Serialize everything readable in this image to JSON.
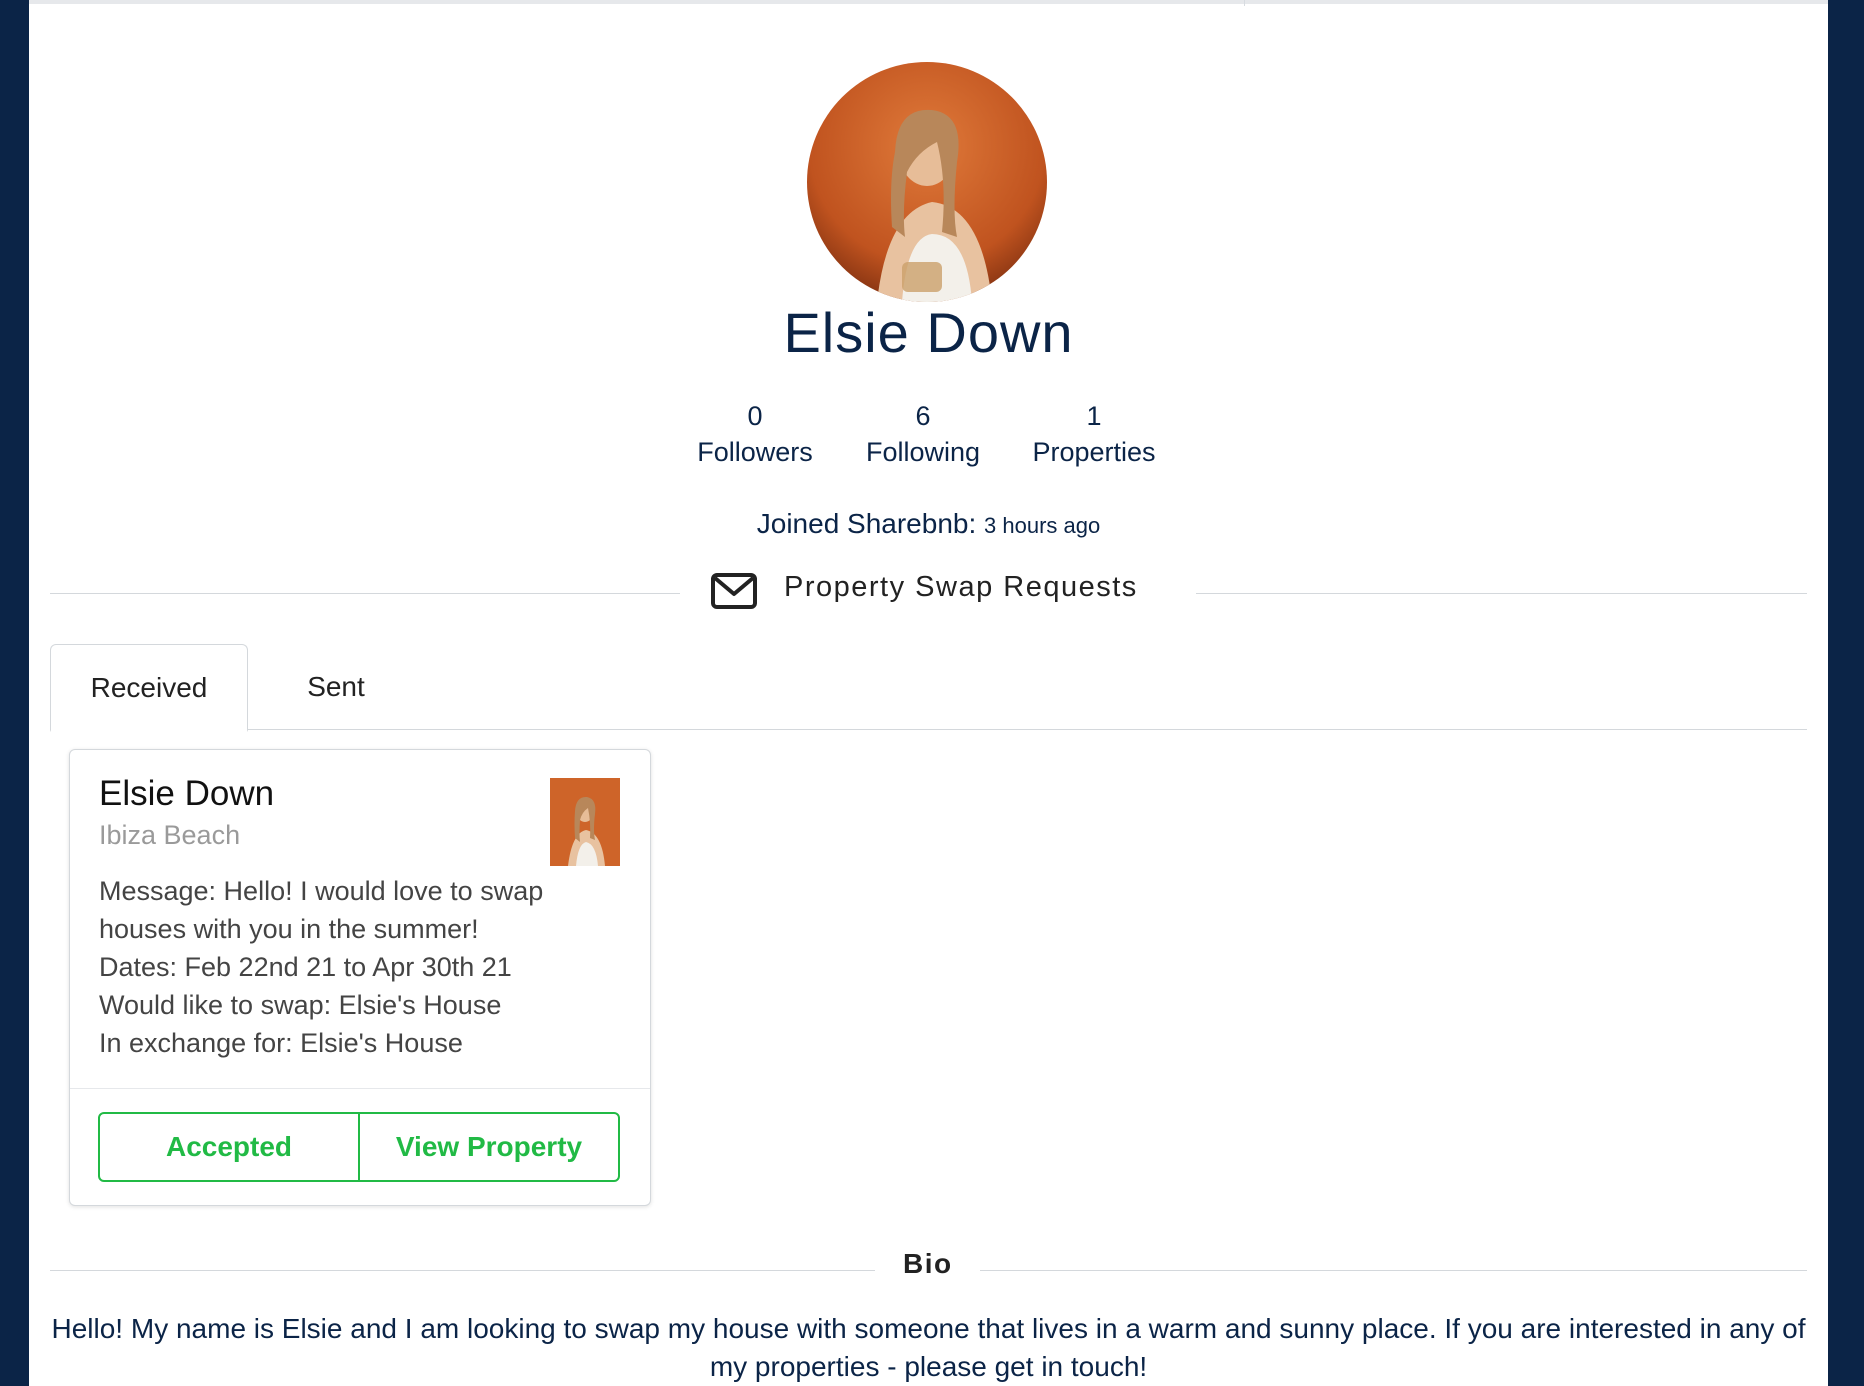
{
  "profile": {
    "name": "Elsie Down",
    "stats": [
      {
        "value": "0",
        "label": "Followers"
      },
      {
        "value": "6",
        "label": "Following"
      },
      {
        "value": "1",
        "label": "Properties"
      }
    ],
    "joined_label": "Joined Sharebnb:",
    "joined_ago": "3 hours ago"
  },
  "requests": {
    "title": "Property Swap Requests",
    "icon": "envelope-icon",
    "tabs": [
      {
        "label": "Received",
        "active": true
      },
      {
        "label": "Sent",
        "active": false
      }
    ],
    "card": {
      "name": "Elsie Down",
      "location": "Ibiza Beach",
      "lines": [
        "Message: Hello! I would love to swap houses with you in the summer!",
        "Dates: Feb 22nd 21 to Apr 30th 21",
        "Would like to swap: Elsie's House",
        "In exchange for: Elsie's House"
      ],
      "accepted_label": "Accepted",
      "view_label": "View Property"
    }
  },
  "bio": {
    "title": "Bio",
    "text": "Hello! My name is Elsie and I am looking to swap my house with someone that lives in a warm and sunny place. If you are interested in any of my properties - please get in touch!"
  },
  "colors": {
    "navy": "#0b2447",
    "green": "#21ba45"
  }
}
